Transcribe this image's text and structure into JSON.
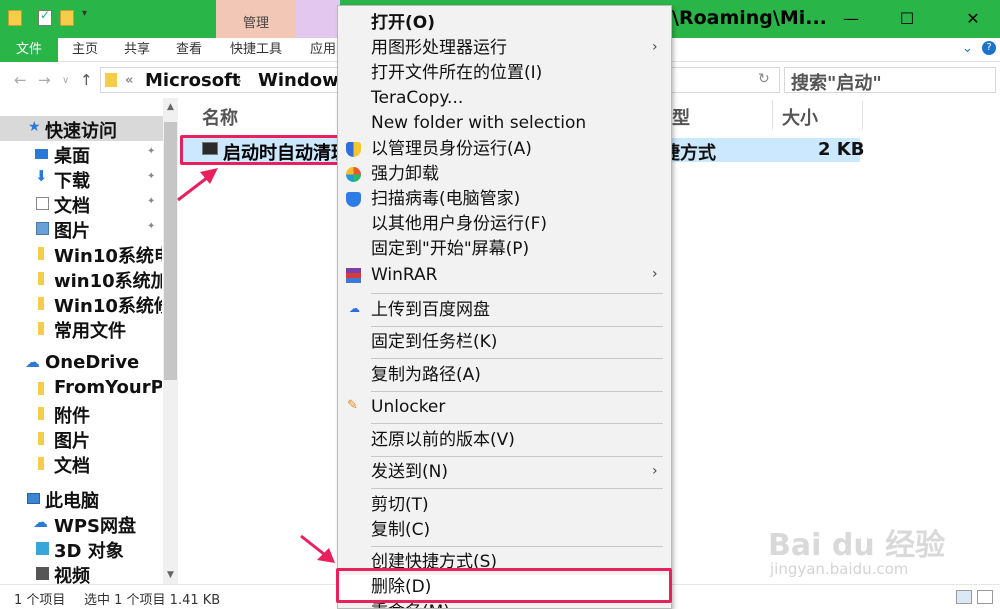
{
  "window": {
    "title": "\\Roaming\\Mi...",
    "tab_context": "管理",
    "controls": {
      "minimize": "—",
      "maximize": "☐",
      "close": "✕"
    }
  },
  "ribbon": {
    "tabs": [
      "文件",
      "主页",
      "共享",
      "查看",
      "快捷工具",
      "应用"
    ],
    "expand_icon": "chevron-down-icon",
    "help_icon": "help-icon"
  },
  "address": {
    "prefix": "«",
    "crumbs": [
      "Microsoft",
      "Windows"
    ],
    "search_placeholder": "搜索\"启动\""
  },
  "sidebar": {
    "items": [
      {
        "label": "快速访问",
        "icon": "star-icon",
        "pinned": false,
        "selected": true
      },
      {
        "label": "桌面",
        "icon": "desktop-icon",
        "pinned": true
      },
      {
        "label": "下载",
        "icon": "download-icon",
        "pinned": true
      },
      {
        "label": "文档",
        "icon": "document-icon",
        "pinned": true
      },
      {
        "label": "图片",
        "icon": "picture-icon",
        "pinned": true
      },
      {
        "label": "Win10系统电",
        "icon": "folder-icon",
        "pinned": false
      },
      {
        "label": "win10系统加",
        "icon": "folder-icon",
        "pinned": false
      },
      {
        "label": "Win10系统修",
        "icon": "folder-icon",
        "pinned": false
      },
      {
        "label": "常用文件",
        "icon": "folder-icon",
        "pinned": false
      },
      {
        "label": "OneDrive",
        "icon": "cloud-icon",
        "pinned": false
      },
      {
        "label": "FromYourPh",
        "icon": "folder-icon",
        "pinned": false
      },
      {
        "label": "附件",
        "icon": "folder-icon",
        "pinned": false
      },
      {
        "label": "图片",
        "icon": "folder-icon",
        "pinned": false
      },
      {
        "label": "文档",
        "icon": "folder-icon",
        "pinned": false
      },
      {
        "label": "此电脑",
        "icon": "computer-icon",
        "pinned": false
      },
      {
        "label": "WPS网盘",
        "icon": "cloud-icon",
        "pinned": false
      },
      {
        "label": "3D 对象",
        "icon": "cube-icon",
        "pinned": false
      },
      {
        "label": "视频",
        "icon": "video-icon",
        "pinned": false
      }
    ]
  },
  "filelist": {
    "columns": {
      "name": "名称",
      "type": "型",
      "size": "大小"
    },
    "rows": [
      {
        "name": "启动时自动清理",
        "type": "捷方式",
        "size": "2 KB"
      }
    ]
  },
  "status": {
    "count": "1 个项目",
    "selected": "选中 1 个项目  1.41 KB"
  },
  "context_menu": {
    "items": [
      {
        "label": "打开(O)",
        "bold": true
      },
      {
        "label": "用图形处理器运行",
        "submenu": true
      },
      {
        "label": "打开文件所在的位置(I)"
      },
      {
        "label": "TeraCopy..."
      },
      {
        "label": "New folder with selection"
      },
      {
        "label": "以管理员身份运行(A)",
        "icon": "uac-shield-icon"
      },
      {
        "label": "强力卸载",
        "icon": "uninstall-icon"
      },
      {
        "label": "扫描病毒(电脑管家)",
        "icon": "antivirus-icon"
      },
      {
        "label": "以其他用户身份运行(F)"
      },
      {
        "label": "固定到\"开始\"屏幕(P)"
      },
      {
        "label": "WinRAR",
        "icon": "winrar-icon",
        "submenu": true
      },
      {
        "label": "上传到百度网盘",
        "icon": "baidu-cloud-icon"
      },
      {
        "label": "固定到任务栏(K)"
      },
      {
        "label": "复制为路径(A)"
      },
      {
        "label": "Unlocker",
        "icon": "unlocker-icon"
      },
      {
        "label": "还原以前的版本(V)"
      },
      {
        "label": "发送到(N)",
        "submenu": true
      },
      {
        "label": "剪切(T)"
      },
      {
        "label": "复制(C)"
      },
      {
        "label": "创建快捷方式(S)"
      },
      {
        "label": "删除(D)"
      },
      {
        "label": "重命名(M)"
      }
    ]
  },
  "annotations": {
    "highlight_color": "#e8205c",
    "watermark": "Bai du 经验",
    "watermark_sub": "jingyan.baidu.com"
  },
  "colors": {
    "accent": "#2ab548",
    "selection": "#cce8ff"
  }
}
